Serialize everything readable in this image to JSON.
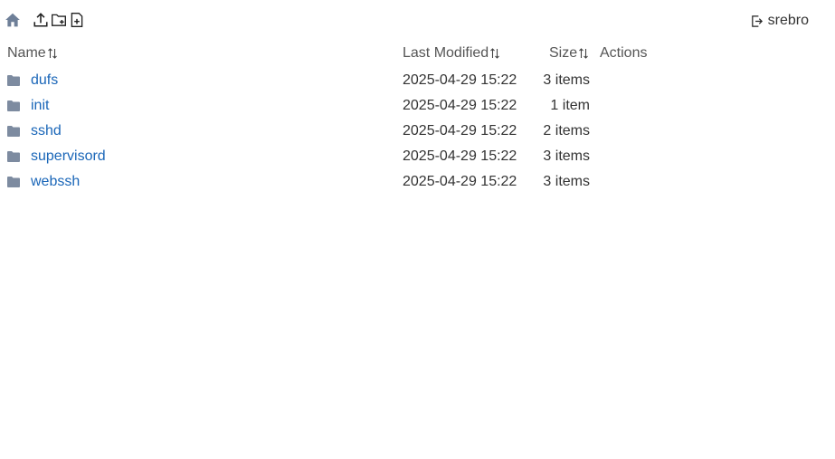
{
  "toolbar": {
    "icons": [
      "home-icon",
      "upload-icon",
      "new-folder-icon",
      "new-file-icon"
    ]
  },
  "user": {
    "name": "srebro",
    "icon": "logout-icon"
  },
  "table": {
    "columns": {
      "name": "Name",
      "modified": "Last Modified",
      "size": "Size",
      "actions": "Actions"
    },
    "rows": [
      {
        "name": "dufs",
        "modified": "2025-04-29 15:22",
        "size": "3 items"
      },
      {
        "name": "init",
        "modified": "2025-04-29 15:22",
        "size": "1 item"
      },
      {
        "name": "sshd",
        "modified": "2025-04-29 15:22",
        "size": "2 items"
      },
      {
        "name": "supervisord",
        "modified": "2025-04-29 15:22",
        "size": "3 items"
      },
      {
        "name": "webssh",
        "modified": "2025-04-29 15:22",
        "size": "3 items"
      }
    ]
  },
  "colors": {
    "link": "#1a66b8",
    "folder": "#7d8ba0",
    "home": "#6e7f98"
  }
}
